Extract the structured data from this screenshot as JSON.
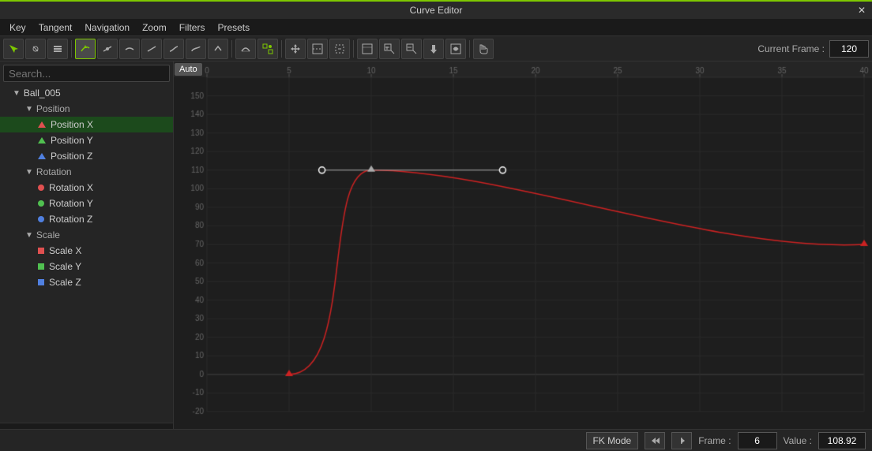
{
  "titleBar": {
    "title": "Curve Editor"
  },
  "menuBar": {
    "items": [
      "Key",
      "Tangent",
      "Navigation",
      "Zoom",
      "Filters",
      "Presets"
    ]
  },
  "toolbar": {
    "tooltip": "Auto",
    "currentFrameLabel": "Current Frame :",
    "currentFrameValue": "120"
  },
  "sidebar": {
    "searchPlaceholder": "Search...",
    "tree": {
      "root": "Ball_005",
      "groups": [
        {
          "name": "Position",
          "children": [
            {
              "name": "Position X",
              "colorClass": "tri-red",
              "selected": true
            },
            {
              "name": "Position Y",
              "colorClass": "tri-green"
            },
            {
              "name": "Position Z",
              "colorClass": "tri-blue"
            }
          ]
        },
        {
          "name": "Rotation",
          "children": [
            {
              "name": "Rotation X",
              "dotColor": "#e05050"
            },
            {
              "name": "Rotation Y",
              "dotColor": "#50c050"
            },
            {
              "name": "Rotation Z",
              "dotColor": "#5080e0"
            }
          ]
        },
        {
          "name": "Scale",
          "children": [
            {
              "name": "Scale X",
              "sqColor": "#e05050"
            },
            {
              "name": "Scale Y",
              "sqColor": "#50c050"
            },
            {
              "name": "Scale Z",
              "sqColor": "#5080e0"
            }
          ]
        }
      ]
    }
  },
  "statusBar": {
    "fkModeLabel": "FK Mode",
    "frameLabel": "Frame :",
    "frameValue": "6",
    "valueLabel": "Value :",
    "valueValue": "108.92"
  },
  "ruler": {
    "ticks": [
      0,
      5,
      10,
      15,
      20,
      25,
      30,
      35,
      40
    ]
  },
  "yAxis": {
    "labels": [
      150,
      140,
      130,
      120,
      110,
      100,
      90,
      80,
      70,
      60,
      50,
      40,
      30,
      20,
      10,
      0,
      -10,
      -20
    ]
  }
}
